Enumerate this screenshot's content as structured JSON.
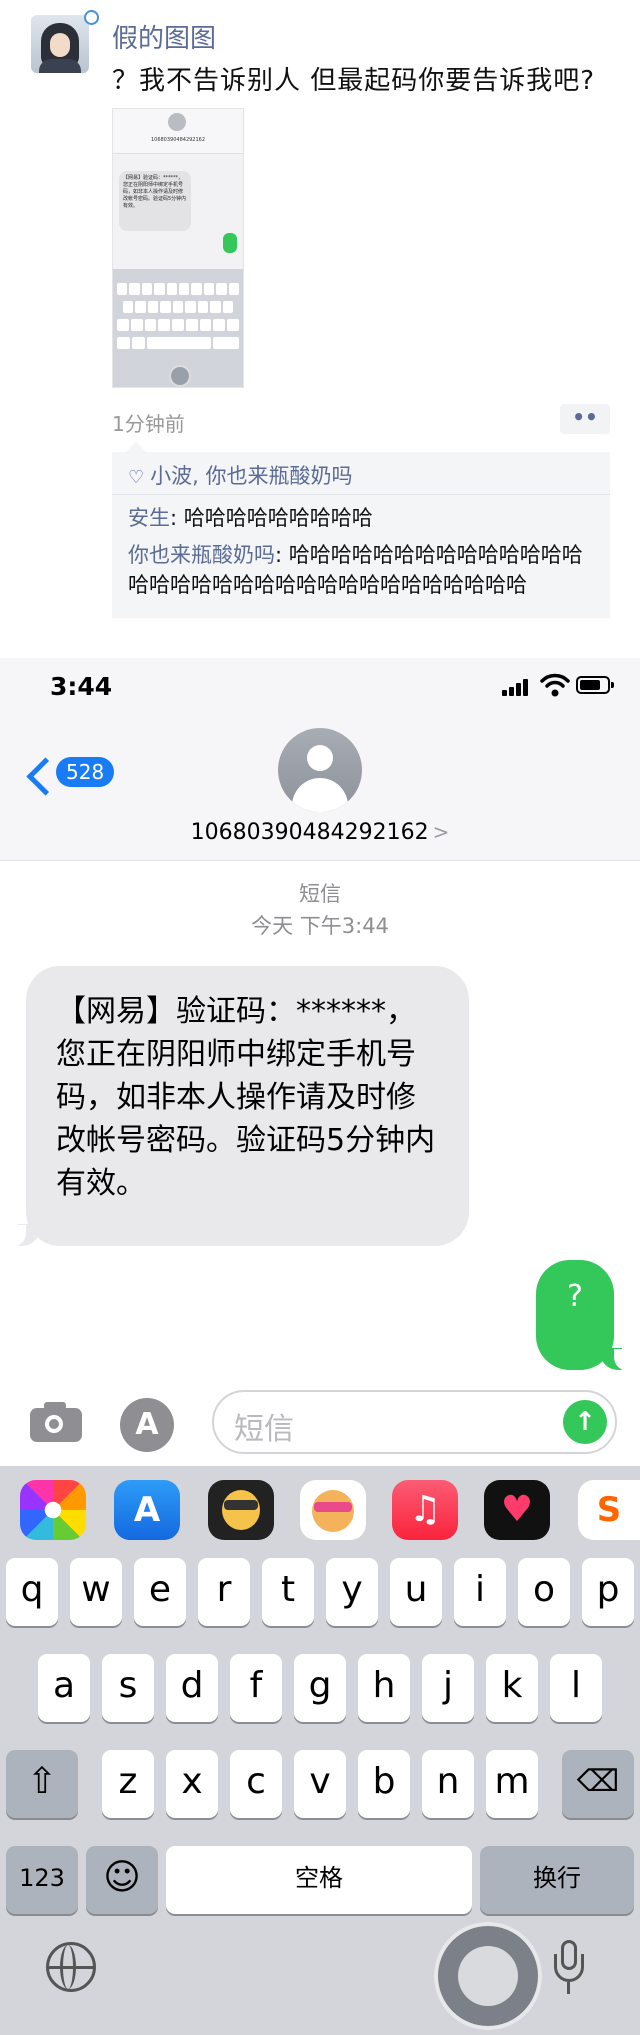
{
  "post": {
    "author": "假的图图",
    "text": "？我不告诉别人 但最起码你要告诉我吧?",
    "time_ago": "1分钟前",
    "more_label": "••",
    "likes": "小波, 你也来瓶酸奶吗",
    "comments": [
      {
        "user": "安生",
        "text": "哈哈哈哈哈哈哈哈哈"
      },
      {
        "user": "你也来瓶酸奶吗",
        "text": "哈哈哈哈哈哈哈哈哈哈哈哈哈哈哈哈哈哈哈哈哈哈哈哈哈哈哈哈哈哈哈哈哈"
      }
    ]
  },
  "phone": {
    "status_time": "3:44",
    "back_count": "528",
    "contact_number": "10680390484292162",
    "meta_type": "短信",
    "meta_time": "今天 下午3:44",
    "incoming_message": "【网易】验证码：******，您正在阴阳师中绑定手机号码，如非本人操作请及时修改帐号密码。验证码5分钟内有效。",
    "outgoing_message": "?",
    "input_placeholder": "短信",
    "send_icon": "arrow-up",
    "appstore_glyph": "A"
  },
  "keyboard": {
    "row1": [
      "q",
      "w",
      "e",
      "r",
      "t",
      "y",
      "u",
      "i",
      "o",
      "p"
    ],
    "row2": [
      "a",
      "s",
      "d",
      "f",
      "g",
      "h",
      "j",
      "k",
      "l"
    ],
    "row3": [
      "z",
      "x",
      "c",
      "v",
      "b",
      "n",
      "m"
    ],
    "shift": "⇧",
    "delete": "⌫",
    "numbers": "123",
    "emoji": "☺",
    "space": "空格",
    "return": "换行"
  },
  "colors": {
    "link_blue": "#5b6b95",
    "ios_blue": "#1a7cf5",
    "imessage_green": "#34c759",
    "bubble_gray": "#e9e9eb",
    "keyboard_bg": "#d3d5db"
  }
}
